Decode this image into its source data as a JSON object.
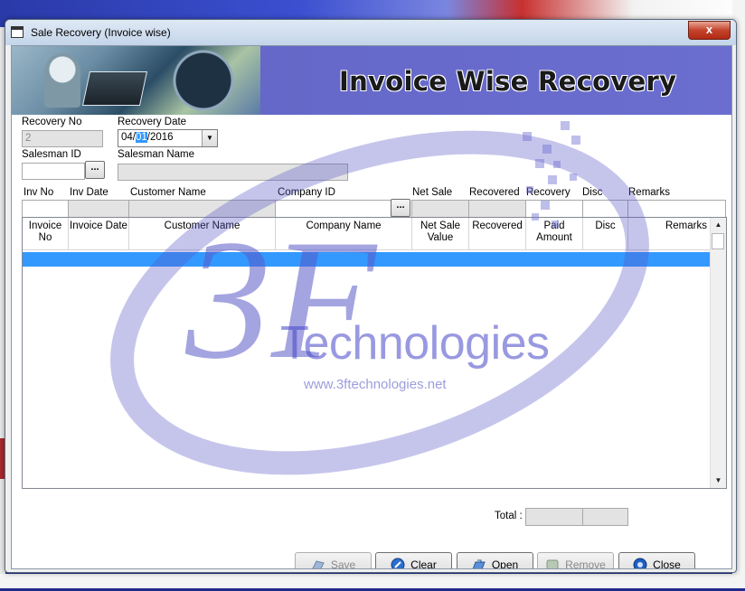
{
  "window": {
    "title": "Sale Recovery (Invoice wise)",
    "close_glyph": "x"
  },
  "banner": {
    "title": "Invoice Wise Recovery"
  },
  "form": {
    "recovery_no_label": "Recovery No",
    "recovery_no_value": "2",
    "recovery_date_label": "Recovery Date",
    "recovery_date_pre": "04/",
    "recovery_date_sel": "01",
    "recovery_date_post": "/2016",
    "salesman_id_label": "Salesman ID",
    "salesman_id_value": "",
    "salesman_name_label": "Salesman Name",
    "salesman_name_value": "",
    "browse_label": "..."
  },
  "entry_labels": {
    "inv_no": "Inv  No",
    "inv_date": "Inv Date",
    "customer_name": "Customer Name",
    "company_id": "Company ID",
    "net_sale": "Net Sale",
    "recovered": "Recovered",
    "recovery": "Recovery",
    "disc": "Disc",
    "remarks": "Remarks"
  },
  "grid": {
    "columns": [
      "Invoice No",
      "Invoice Date",
      "Customer Name",
      "Company Name",
      "Net Sale Value",
      "Recovered",
      "Paid Amount",
      "Disc",
      "Remarks"
    ],
    "rows": []
  },
  "totals": {
    "label": "Total :"
  },
  "buttons": {
    "save": "Save",
    "clear": "Clear",
    "open": "Open",
    "remove": "Remove",
    "close": "Close"
  },
  "watermark": {
    "brand": "Technologies",
    "url": "www.3ftechnologies.net"
  },
  "colors": {
    "banner": "#6568c8",
    "selection": "#3399ff",
    "watermark": "#5a5ac8",
    "close_button": "#c4432c"
  }
}
